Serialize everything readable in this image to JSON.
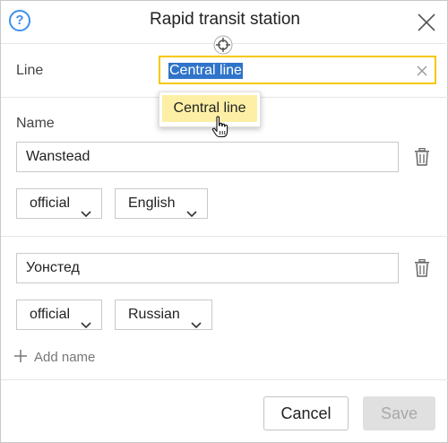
{
  "dialog": {
    "title": "Rapid transit station",
    "help_glyph": "?",
    "icons": [
      "help-icon",
      "close-icon",
      "target-icon"
    ]
  },
  "line_field": {
    "label": "Line",
    "value": "Central line",
    "dropdown_option": "Central line"
  },
  "names_section": {
    "label": "Name",
    "entries": [
      {
        "value": "Wanstead",
        "type": "official",
        "language": "English"
      },
      {
        "value": "Уонстед",
        "type": "official",
        "language": "Russian"
      }
    ],
    "add_name_label": "Add name"
  },
  "footer": {
    "cancel_label": "Cancel",
    "save_label": "Save"
  },
  "colors": {
    "accent_yellow": "#f6c800",
    "help_blue": "#3d8ff0",
    "selection_blue": "#2f74c9",
    "dropdown_highlight": "#fdf0a6"
  }
}
